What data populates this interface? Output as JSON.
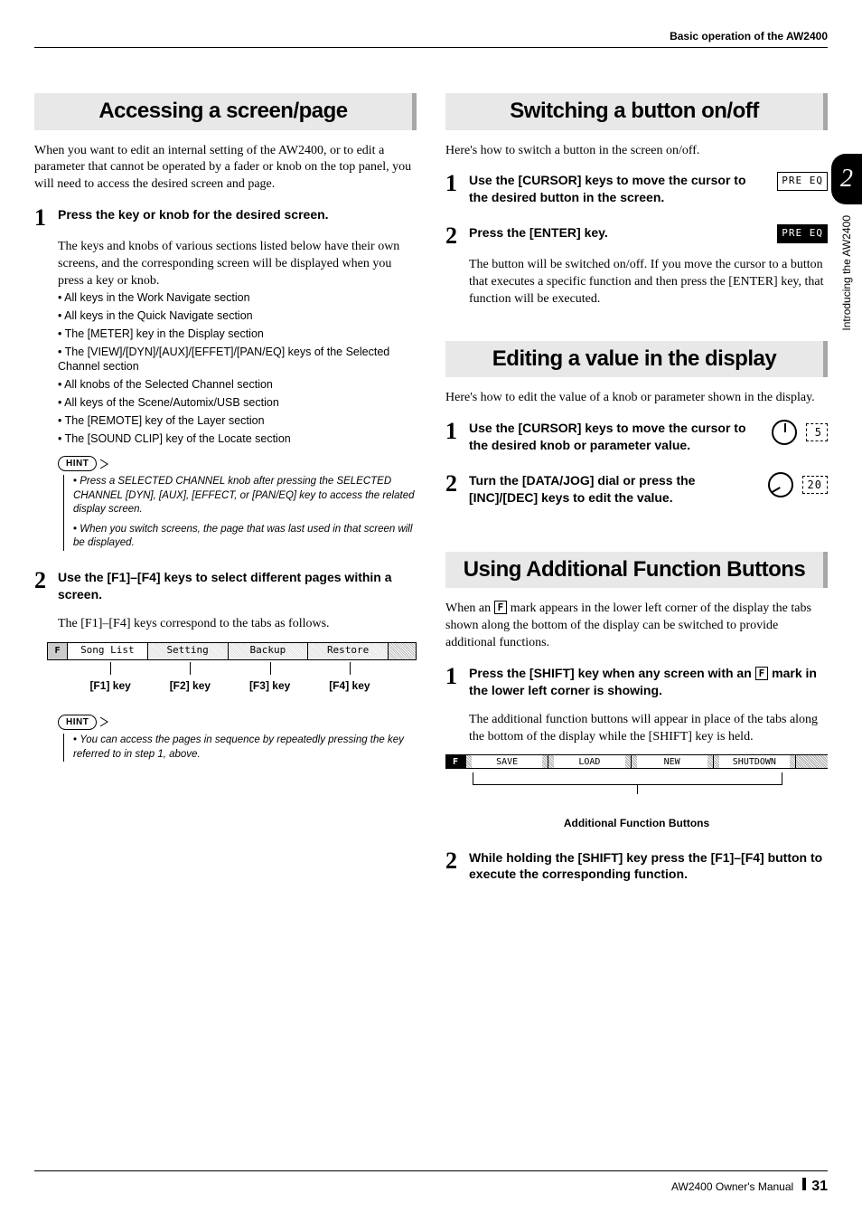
{
  "header": {
    "top_right": "Basic operation of the AW2400"
  },
  "left": {
    "h1": "Accessing a screen/page",
    "intro": "When you want to edit an internal setting of the AW2400, or to edit a parameter that cannot be operated by a fader or knob on the top panel, you will need to access the desired screen and page.",
    "s1_num": "1",
    "s1_title": "Press the key or knob for the desired screen.",
    "s1_text": "The keys and knobs of various sections listed below have their own screens, and the corresponding screen will be displayed when you press a key or knob.",
    "bullets": [
      "All keys in the Work Navigate section",
      "All keys in the Quick Navigate section",
      "The [METER] key in the Display section",
      "The [VIEW]/[DYN]/[AUX]/[EFFET]/[PAN/EQ] keys of the Selected Channel section",
      "All knobs of the Selected Channel section",
      "All keys of the Scene/Automix/USB section",
      "The [REMOTE] key of the Layer section",
      "The [SOUND CLIP] key of the Locate section"
    ],
    "hint_label": "HINT",
    "hint1a": "Press a SELECTED CHANNEL knob after pressing the SELECTED CHANNEL [DYN], [AUX], [EFFECT, or [PAN/EQ] key to access the related display screen.",
    "hint1b": "When you switch screens, the page that was last used in that screen will be displayed.",
    "s2_num": "2",
    "s2_title": "Use the [F1]–[F4] keys to select different pages within a screen.",
    "s2_text": "The [F1]–[F4] keys correspond to the tabs as follows.",
    "tabs": {
      "icon": "F",
      "t1": "Song List",
      "t2": "Setting",
      "t3": "Backup",
      "t4": "Restore",
      "k1": "[F1] key",
      "k2": "[F2] key",
      "k3": "[F3] key",
      "k4": "[F4] key"
    },
    "hint2": "You can access the pages in sequence by repeatedly pressing the key referred to in step 1, above."
  },
  "right": {
    "sec_a": {
      "h": "Switching a button on/off",
      "intro": "Here's how to switch a button in the screen on/off.",
      "s1_num": "1",
      "s1_title": "Use the [CURSOR] keys to move the cursor to the desired button in the screen.",
      "illus1": "PRE EQ",
      "s2_num": "2",
      "s2_title": "Press the [ENTER] key.",
      "s2_text": "The button will be switched on/off. If you move the cursor to a button that executes a specific function and then press the [ENTER] key, that function will be executed.",
      "illus2": "PRE EQ"
    },
    "sec_b": {
      "h": "Editing a value in the display",
      "intro": "Here's how to edit the value of a knob or parameter shown in the display.",
      "s1_num": "1",
      "s1_title": "Use the [CURSOR] keys to move the cursor to the desired knob or parameter value.",
      "val1": "5",
      "s2_num": "2",
      "s2_title": "Turn the [DATA/JOG] dial or press the [INC]/[DEC] keys to edit the value.",
      "val2": "20"
    },
    "sec_c": {
      "h": "Using Additional Function Buttons",
      "intro_a": "When an ",
      "f_mark": "F",
      "intro_b": " mark appears in the lower left corner of the display the tabs shown along the bottom of the display can be switched to provide additional functions.",
      "s1_num": "1",
      "s1_title_a": "Press the [SHIFT] key when any screen with an ",
      "s1_title_b": " mark in the lower left corner is showing.",
      "s1_text": "The additional function buttons will appear in place of the tabs along the bottom of the display while the [SHIFT] key is held.",
      "func": {
        "icon": "F",
        "b1": "SAVE",
        "b2": "LOAD",
        "b3": "NEW",
        "b4": "SHUTDOWN",
        "caption": "Additional Function Buttons"
      },
      "s2_num": "2",
      "s2_title": "While holding the [SHIFT] key press the [F1]–[F4] button to execute the corresponding function."
    }
  },
  "side": {
    "chapter": "2",
    "label": "Introducing the AW2400"
  },
  "footer": {
    "manual": "AW2400  Owner's Manual",
    "page": "31"
  }
}
